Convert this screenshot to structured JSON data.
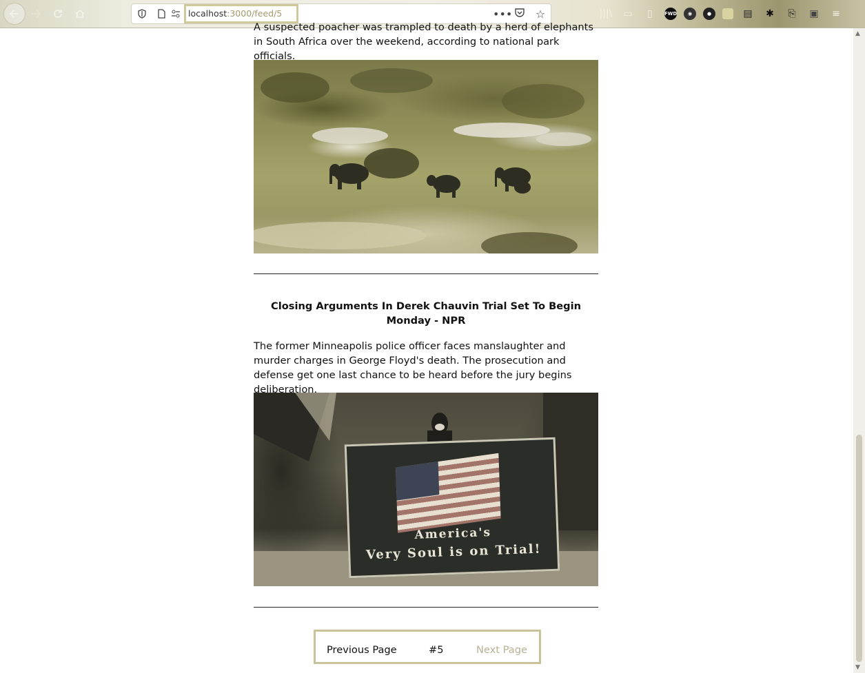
{
  "browser": {
    "url_host": "localhost",
    "url_rest": ":3000/feed/5",
    "toolbar_icons": [
      "library-icon",
      "reader-view-icon",
      "fwd-extension-icon",
      "dark-globe-extension-icon",
      "green-extension-icon",
      "notes-extension-icon",
      "gear-extension-icon",
      "screenshot-extension-icon",
      "picture-extension-icon",
      "menu-icon"
    ]
  },
  "articles": [
    {
      "summary": "A suspected poacher was trampled to death by a herd of elephants in South Africa over the weekend, according to national park officials."
    },
    {
      "title": "Closing Arguments In Derek Chauvin Trial Set To Begin Monday - NPR",
      "summary": "The former Minneapolis police officer faces manslaughter and murder charges in George Floyd's death. The prosecution and defense get one last chance to be heard before the jury begins deliberation.",
      "sign_line1": "America's",
      "sign_line2": "Very Soul is on Trial!"
    }
  ],
  "pagination": {
    "previous_label": "Previous Page",
    "page_number": "#5",
    "next_label": "Next Page"
  },
  "colors": {
    "accent_border": "#c9c29a",
    "disabled_text": "#b8b196"
  }
}
